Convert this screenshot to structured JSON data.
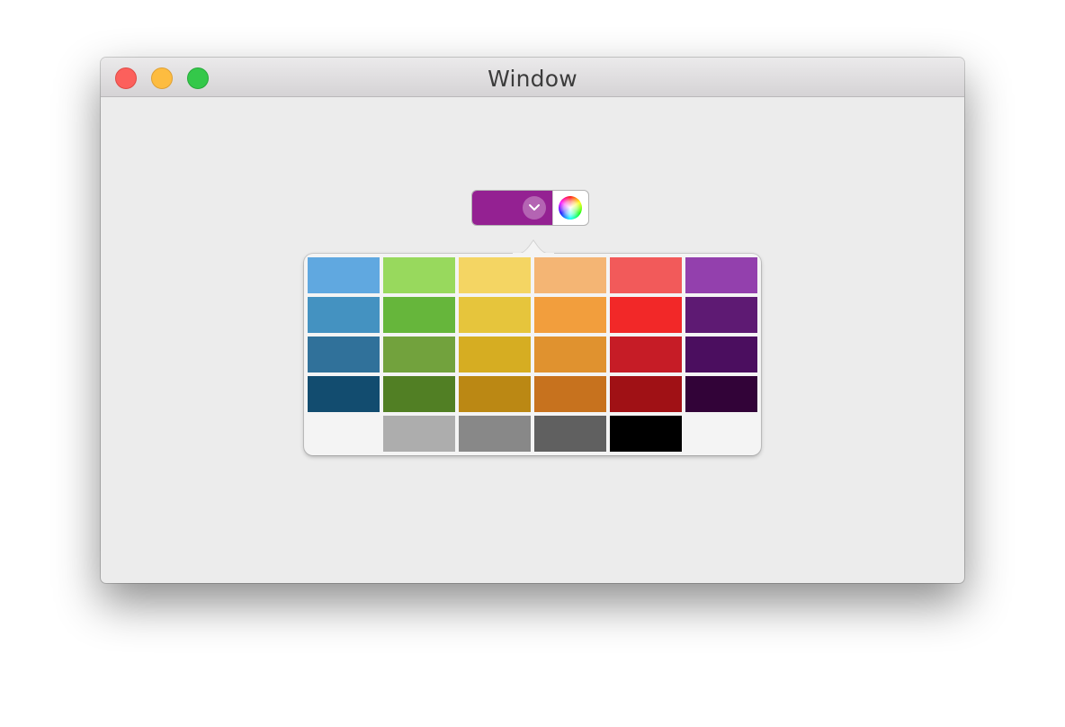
{
  "window": {
    "title": "Window"
  },
  "color_well": {
    "selected_color": "#942192",
    "icons": {
      "dropdown": "chevron-down-icon",
      "color_wheel": "color-wheel-icon"
    }
  },
  "palette": {
    "rows": [
      [
        "#60a8e0",
        "#98d95d",
        "#f4d563",
        "#f4b574",
        "#f25a5a",
        "#9340ad"
      ],
      [
        "#4492c1",
        "#66b63b",
        "#e6c53c",
        "#f29e3d",
        "#f22828",
        "#5e1a73"
      ],
      [
        "#30719a",
        "#72a23d",
        "#d6ad22",
        "#e0922f",
        "#c61c26",
        "#4b0e5f"
      ],
      [
        "#124c6f",
        "#517f24",
        "#bb8814",
        "#c7721e",
        "#a01115",
        "#320338"
      ],
      [
        null,
        "#adadad",
        "#888888",
        "#606060",
        "#000000",
        null
      ]
    ]
  }
}
